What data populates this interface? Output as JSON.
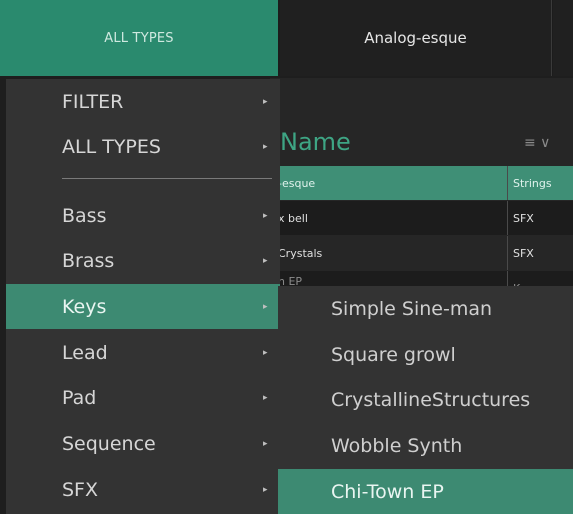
{
  "top_tabs": {
    "all_types": "ALL TYPES",
    "preset_name": "Analog-esque"
  },
  "list": {
    "column_name": "Name",
    "sort_icon": "≡ ∨",
    "rows": [
      {
        "name": "-esque",
        "type": "Strings"
      },
      {
        "name": "x bell",
        "type": "SFX"
      },
      {
        "name": "Crystals",
        "type": "SFX"
      },
      {
        "name": "n EP",
        "type": "Keys"
      }
    ]
  },
  "menu": {
    "items": [
      {
        "label": "FILTER",
        "has_submenu": true
      },
      {
        "label": "ALL TYPES",
        "has_submenu": true
      },
      {
        "label": "Bass",
        "has_submenu": true
      },
      {
        "label": "Brass",
        "has_submenu": true
      },
      {
        "label": "Keys",
        "has_submenu": true,
        "active": true
      },
      {
        "label": "Lead",
        "has_submenu": true
      },
      {
        "label": "Pad",
        "has_submenu": true
      },
      {
        "label": "Sequence",
        "has_submenu": true
      },
      {
        "label": "SFX",
        "has_submenu": true
      }
    ],
    "arrow": "▸"
  },
  "submenu": {
    "items": [
      {
        "label": "Simple Sine-man"
      },
      {
        "label": "Square growl"
      },
      {
        "label": "CrystallineStructures"
      },
      {
        "label": "Wobble Synth"
      },
      {
        "label": "Chi-Town EP",
        "active": true
      }
    ]
  },
  "colors": {
    "accent": "#2a8a6e",
    "highlight": "#3d8a72",
    "menu_bg": "#333333"
  }
}
